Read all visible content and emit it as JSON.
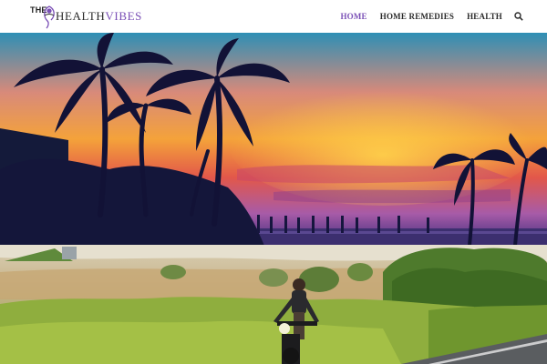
{
  "header": {
    "logo": {
      "prefix": "THE",
      "word_part1": "HEALTH",
      "word_part2": "VIBES"
    },
    "nav": [
      {
        "label": "HOME",
        "active": true
      },
      {
        "label": "HOME REMEDIES",
        "active": false
      },
      {
        "label": "HEALTH",
        "active": false
      }
    ],
    "search_icon": "search-icon"
  },
  "colors": {
    "accent": "#7a4fb6",
    "nav_text": "#2b2b2b"
  }
}
